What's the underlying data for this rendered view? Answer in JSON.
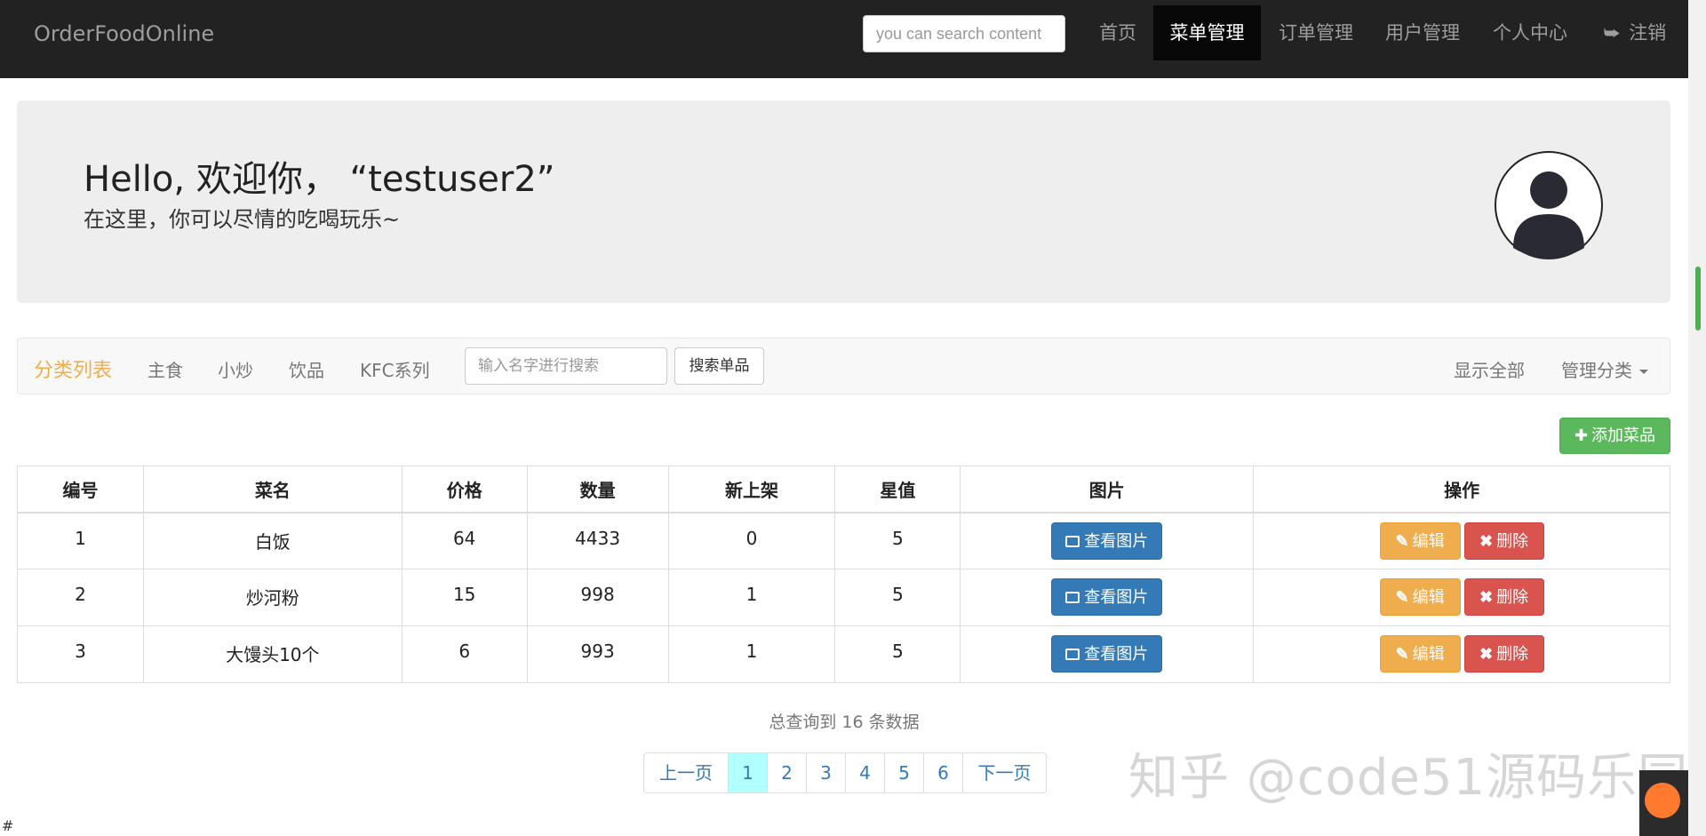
{
  "nav": {
    "brand": "OrderFoodOnline",
    "search_placeholder": "you can search content",
    "items": [
      "首页",
      "菜单管理",
      "订单管理",
      "用户管理",
      "个人中心"
    ],
    "logout": "注销"
  },
  "jumbotron": {
    "greeting": "Hello, 欢迎你，  “testuser2”",
    "subtitle": "在这里，你可以尽情的吃喝玩乐~"
  },
  "category_bar": {
    "title": "分类列表",
    "categories": [
      "主食",
      "小炒",
      "饮品",
      "KFC系列"
    ],
    "search_placeholder": "输入名字进行搜索",
    "search_button": "搜索单品",
    "show_all": "显示全部",
    "manage": "管理分类"
  },
  "add_button": "添加菜品",
  "table": {
    "headers": [
      "编号",
      "菜名",
      "价格",
      "数量",
      "新上架",
      "星值",
      "图片",
      "操作"
    ],
    "rows": [
      [
        "1",
        "白饭",
        "64",
        "4433",
        "0",
        "5"
      ],
      [
        "2",
        "炒河粉",
        "15",
        "998",
        "1",
        "5"
      ],
      [
        "3",
        "大馒头10个",
        "6",
        "993",
        "1",
        "5"
      ]
    ],
    "view_image": "查看图片",
    "edit": "编辑",
    "delete": "删除"
  },
  "total_text": "总查询到 16 条数据",
  "pagination": {
    "prev": "上一页",
    "pages": [
      "1",
      "2",
      "3",
      "4",
      "5",
      "6"
    ],
    "current": "1",
    "next": "下一页"
  },
  "watermark": "知乎 @code51源码乐园",
  "footer_hash": "#",
  "colors": {
    "navbar": "#222222",
    "accent_orange": "#f0ad4e",
    "primary_blue": "#337ab7",
    "success_green": "#5cb85c",
    "danger_red": "#d9534f"
  }
}
